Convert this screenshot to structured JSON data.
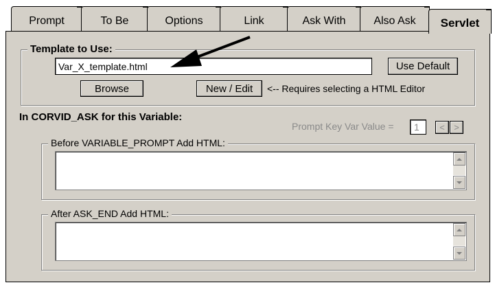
{
  "tabs": [
    {
      "label": "Prompt",
      "active": false
    },
    {
      "label": "To Be",
      "active": false
    },
    {
      "label": "Options",
      "active": false
    },
    {
      "label": "Link",
      "active": false
    },
    {
      "label": "Ask With",
      "active": false
    },
    {
      "label": "Also Ask",
      "active": false
    },
    {
      "label": "Servlet",
      "active": true
    }
  ],
  "template": {
    "legend": "Template to Use:",
    "value": "Var_X_template.html",
    "use_default": "Use Default",
    "browse": "Browse",
    "new_edit": "New / Edit",
    "hint": "<-- Requires selecting a HTML Editor"
  },
  "corvid": {
    "heading": "In CORVID_ASK for this Variable:",
    "prompt_key_label": "Prompt Key Var Value =",
    "prompt_key_value": "1",
    "prev": "<",
    "next": ">"
  },
  "before": {
    "legend": "Before VARIABLE_PROMPT Add HTML:",
    "value": ""
  },
  "after": {
    "legend": "After ASK_END Add HTML:",
    "value": ""
  },
  "icons": {
    "arrow": "arrow-pointer-icon"
  },
  "colors": {
    "face": "#d4d0c8",
    "shadow": "#808080",
    "disabled_text": "#8a8a8a"
  }
}
